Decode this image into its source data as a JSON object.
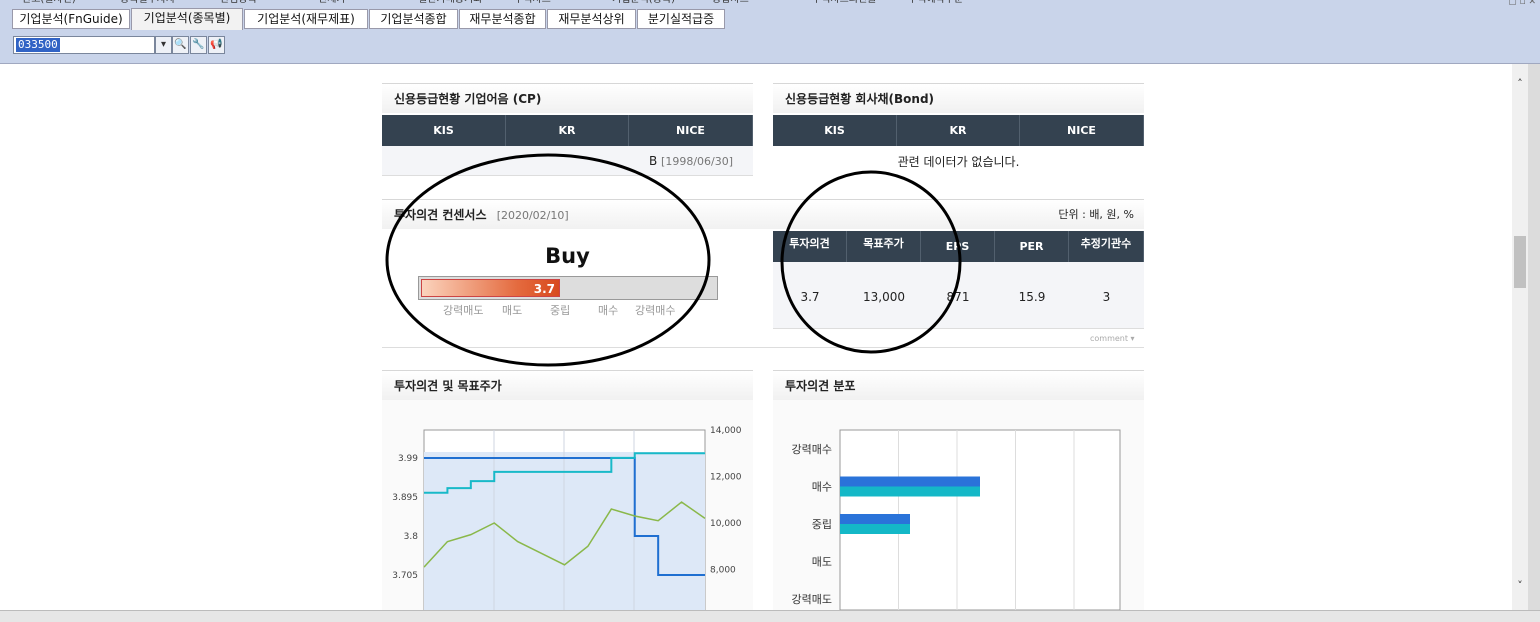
{
  "top_strip": [
    "관고(일자전)",
    "종목별투자자",
    "관심종목",
    "전체가",
    "일간가매동기화",
    "주식차트",
    "기업분석(종목)",
    "종합차트",
    "주식차트외전술",
    "주식예약주문"
  ],
  "tabs": [
    "기업분석(FnGuide)",
    "기업분석(종목별)",
    "기업분석(재무제표)",
    "기업분석종합",
    "재무분석종합",
    "재무분석상위",
    "분기실적급증"
  ],
  "active_tab": 1,
  "toolbar": {
    "stock_code": "033500"
  },
  "credit_cp": {
    "title": "신용등급현황 기업어음 (CP)",
    "headers": [
      "KIS",
      "KR",
      "NICE"
    ],
    "nice_value": "B",
    "nice_date": "[1998/06/30]"
  },
  "credit_bond": {
    "title": "신용등급현황 회사채(Bond)",
    "headers": [
      "KIS",
      "KR",
      "NICE"
    ],
    "no_data": "관련 데이터가 없습니다."
  },
  "consensus": {
    "title": "투자의견 컨센서스",
    "date": "[2020/02/10]",
    "unit": "단위 : 배, 원, %",
    "rating": "Buy",
    "score": "3.7",
    "score_fraction": 0.74,
    "scale": [
      "강력매도",
      "매도",
      "중립",
      "매수",
      "강력매수"
    ],
    "headers": [
      "투자의견",
      "목표주가",
      "EPS",
      "PER",
      "추정기관수"
    ],
    "values": [
      "3.7",
      "13,000",
      "871",
      "15.9",
      "3"
    ],
    "comment": "comment"
  },
  "opinion_price": {
    "title": "투자의견 및 목표주가"
  },
  "opinion_dist": {
    "title": "투자의견 분포"
  },
  "chart_data": [
    {
      "type": "line",
      "left_ticks": [
        "3.99",
        "3.895",
        "3.8",
        "3.705"
      ],
      "right_ticks": [
        "14,000",
        "12,000",
        "10,000",
        "8,000"
      ],
      "series": [
        {
          "axis": "left",
          "values": [
            3.99,
            3.99,
            3.99,
            3.99,
            3.99,
            3.99,
            3.99,
            3.99,
            3.99,
            3.8,
            3.705,
            3.705,
            3.705
          ]
        },
        {
          "axis": "right",
          "values": [
            11300,
            11500,
            11800,
            12200,
            12200,
            12200,
            12200,
            12200,
            12800,
            13000,
            13000,
            13000,
            13000
          ]
        },
        {
          "axis": "right",
          "values": [
            8100,
            9200,
            9500,
            10000,
            9200,
            8700,
            8200,
            9000,
            10600,
            10300,
            10100,
            10900,
            10200
          ]
        }
      ],
      "colors": [
        "#1f6fd1",
        "#18b9c8",
        "#8ab84a"
      ]
    },
    {
      "type": "bar",
      "categories": [
        "강력매수",
        "매수",
        "중립",
        "매도",
        "강력매도"
      ],
      "series": [
        {
          "values": [
            0,
            2,
            1,
            0,
            0
          ]
        }
      ],
      "colors": [
        "#2a73d9",
        "#14b8c7"
      ]
    }
  ]
}
